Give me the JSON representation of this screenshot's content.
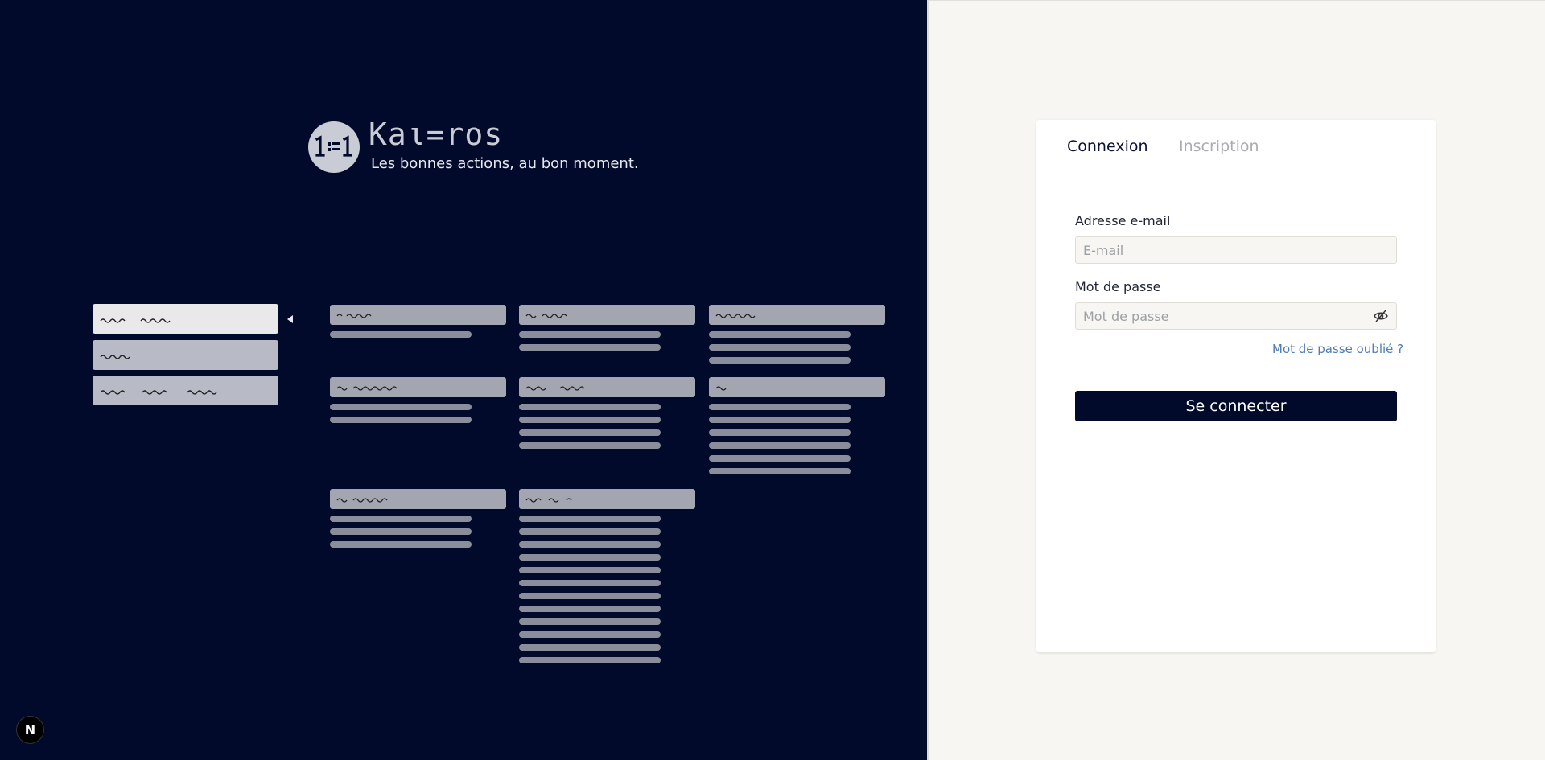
{
  "brand": {
    "name": "Kaι=ros",
    "tagline": "Les bonnes actions, au bon moment.",
    "logo_icon": "kairos-logo-icon"
  },
  "auth": {
    "tabs": [
      {
        "label": "Connexion",
        "active": true
      },
      {
        "label": "Inscription",
        "active": false
      }
    ],
    "email_label": "Adresse e-mail",
    "email_placeholder": "E-mail",
    "password_label": "Mot de passe",
    "password_placeholder": "Mot de passe",
    "password_toggle_icon": "eye-off-icon",
    "forgot_link": "Mot de passe oublié ?",
    "submit_label": "Se connecter"
  },
  "framework_badge": {
    "label": "N"
  },
  "colors": {
    "left_background": "#010a2b",
    "right_background": "#f7f6f2",
    "primary_button": "#010a2b",
    "link": "#4f7bb5"
  }
}
